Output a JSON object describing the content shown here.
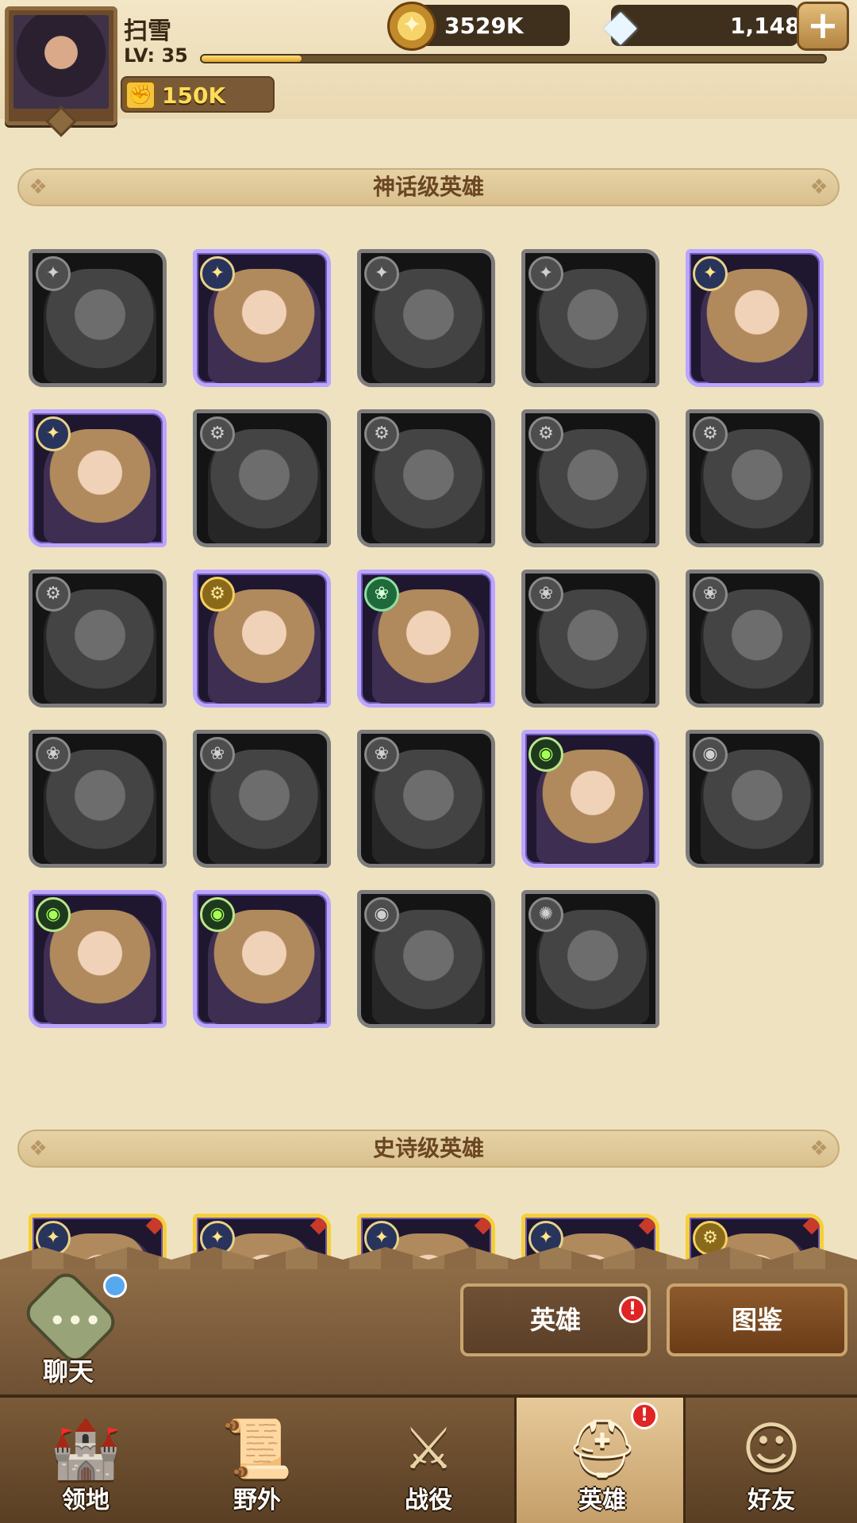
{
  "player": {
    "name": "扫雪",
    "level_label": "LV: 35",
    "xp_fraction": 0.16,
    "power": "150K"
  },
  "currency": {
    "gold": "3529K",
    "gems": "1,148",
    "plus_icon": "+"
  },
  "sections": {
    "mythic_title": "神话级英雄",
    "epic_title": "史诗级英雄"
  },
  "mythic_heroes": [
    {
      "owned": false,
      "faction": "holy"
    },
    {
      "owned": true,
      "faction": "holy"
    },
    {
      "owned": false,
      "faction": "holy"
    },
    {
      "owned": false,
      "faction": "holy"
    },
    {
      "owned": true,
      "faction": "holy"
    },
    {
      "owned": true,
      "faction": "holy"
    },
    {
      "owned": false,
      "faction": "earth"
    },
    {
      "owned": false,
      "faction": "earth"
    },
    {
      "owned": false,
      "faction": "earth"
    },
    {
      "owned": false,
      "faction": "earth"
    },
    {
      "owned": false,
      "faction": "earth"
    },
    {
      "owned": true,
      "faction": "earth"
    },
    {
      "owned": true,
      "faction": "forest"
    },
    {
      "owned": false,
      "faction": "forest"
    },
    {
      "owned": false,
      "faction": "forest"
    },
    {
      "owned": false,
      "faction": "forest"
    },
    {
      "owned": false,
      "faction": "forest"
    },
    {
      "owned": false,
      "faction": "forest"
    },
    {
      "owned": true,
      "faction": "dark"
    },
    {
      "owned": false,
      "faction": "dark"
    },
    {
      "owned": true,
      "faction": "dark"
    },
    {
      "owned": true,
      "faction": "dark"
    },
    {
      "owned": false,
      "faction": "dark"
    },
    {
      "owned": false,
      "faction": "celestial"
    }
  ],
  "epic_heroes": [
    {
      "faction": "holy"
    },
    {
      "faction": "holy"
    },
    {
      "faction": "holy"
    },
    {
      "faction": "holy"
    },
    {
      "faction": "earth"
    }
  ],
  "chat": {
    "label": "聊天"
  },
  "subtabs": {
    "heroes": "英雄",
    "codex": "图鉴",
    "alert": "!"
  },
  "nav": [
    {
      "label": "领地",
      "icon": "castle-icon",
      "glyph": "🏰"
    },
    {
      "label": "野外",
      "icon": "map-scroll-icon",
      "glyph": "📜"
    },
    {
      "label": "战役",
      "icon": "sword-shield-icon",
      "glyph": "⚔"
    },
    {
      "label": "英雄",
      "icon": "helmet-icon",
      "glyph": "⛑"
    },
    {
      "label": "好友",
      "icon": "friends-icon",
      "glyph": "☺"
    }
  ],
  "colors": {
    "owned_border": "#bba6ff",
    "epic_border": "#f5cf38",
    "alert": "#e02424"
  }
}
